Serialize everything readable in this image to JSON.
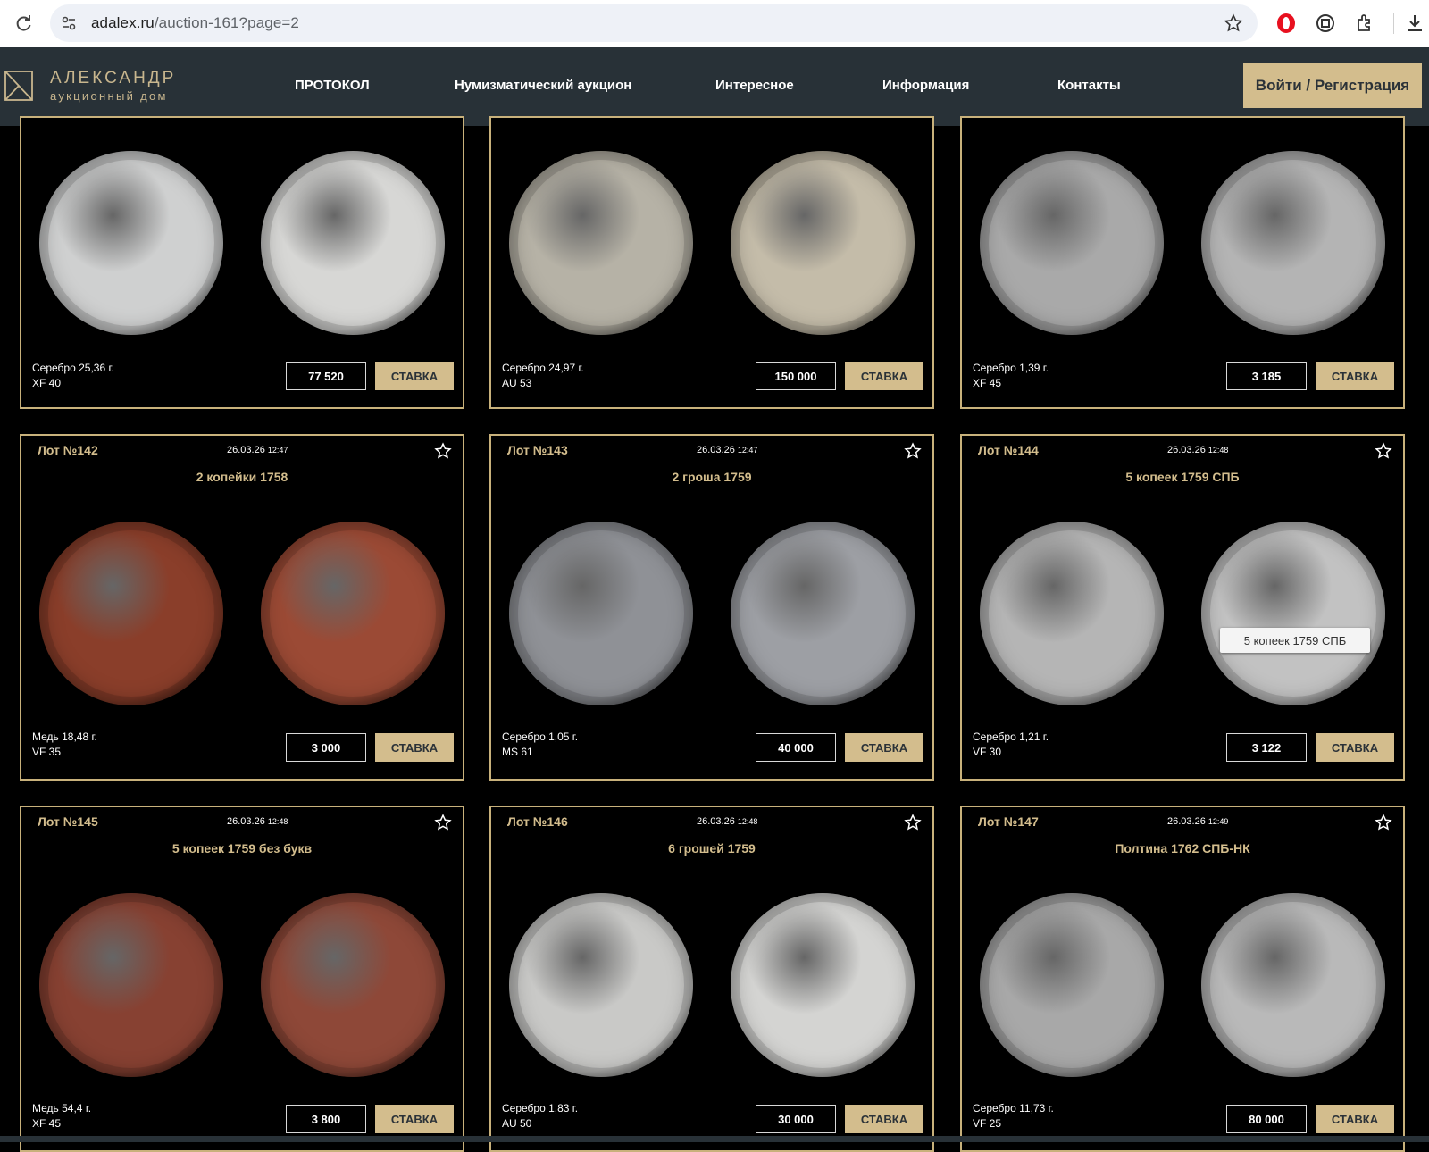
{
  "browser": {
    "url_host": "adalex.ru",
    "url_path": "/auction-161?page=2"
  },
  "header": {
    "logo_title": "АЛЕКСАНДР",
    "logo_subtitle": "аукционный дом",
    "nav": [
      "ПРОТОКОЛ",
      "Нумизматический аукцион",
      "Интересное",
      "Информация",
      "Контакты"
    ],
    "login_label": "Войти / Регистрация"
  },
  "bid_label": "СТАВКА",
  "colors": {
    "accent": "#d3bd8d",
    "header_bg": "#283137",
    "card_border": "#c8b17b"
  },
  "lots": [
    {
      "lot": "",
      "date": "",
      "time": "",
      "title": "",
      "material": "Серебро 25,36 г.",
      "grade": "XF 40",
      "price": "77 520",
      "coin_tones": [
        "#cfd0d0",
        "#d7d7d5"
      ]
    },
    {
      "lot": "",
      "date": "",
      "time": "",
      "title": "",
      "material": "Серебро 24,97 г.",
      "grade": "AU 53",
      "price": "150 000",
      "coin_tones": [
        "#b6b2a6",
        "#c4bca9"
      ]
    },
    {
      "lot": "",
      "date": "",
      "time": "",
      "title": "",
      "material": "Серебро 1,39 г.",
      "grade": "XF 45",
      "price": "3 185",
      "coin_tones": [
        "#a9a9a9",
        "#b4b4b4"
      ]
    },
    {
      "lot": "Лот №142",
      "date": "26.03.26",
      "time": "12:47",
      "title": "2 копейки 1758",
      "material": "Медь 18,48 г.",
      "grade": "VF 35",
      "price": "3 000",
      "coin_tones": [
        "#8a3e2a",
        "#9b4a35"
      ]
    },
    {
      "lot": "Лот №143",
      "date": "26.03.26",
      "time": "12:47",
      "title": "2 гроша 1759",
      "material": "Серебро 1,05 г.",
      "grade": "MS 61",
      "price": "40 000",
      "coin_tones": [
        "#8f9196",
        "#9d9fa4"
      ]
    },
    {
      "lot": "Лот №144",
      "date": "26.03.26",
      "time": "12:48",
      "title": "5 копеек 1759 СПБ",
      "material": "Серебро 1,21 г.",
      "grade": "VF 30",
      "price": "3 122",
      "coin_tones": [
        "#b5b5b5",
        "#c2c2c2"
      ]
    },
    {
      "lot": "Лот №145",
      "date": "26.03.26",
      "time": "12:48",
      "title": "5 копеек 1759 без букв",
      "material": "Медь 54,4 г.",
      "grade": "XF 45",
      "price": "3 800",
      "coin_tones": [
        "#874132",
        "#8e4838"
      ]
    },
    {
      "lot": "Лот №146",
      "date": "26.03.26",
      "time": "12:48",
      "title": "6 грошей 1759",
      "material": "Серебро 1,83 г.",
      "grade": "AU 50",
      "price": "30 000",
      "coin_tones": [
        "#c9c9c7",
        "#d4d4d2"
      ]
    },
    {
      "lot": "Лот №147",
      "date": "26.03.26",
      "time": "12:49",
      "title": "Полтина 1762 СПБ-НК",
      "material": "Серебро 11,73 г.",
      "grade": "VF 25",
      "price": "80 000",
      "coin_tones": [
        "#a8a8a8",
        "#b9b9b9"
      ]
    }
  ],
  "tooltip": "5 копеек 1759 СПБ"
}
